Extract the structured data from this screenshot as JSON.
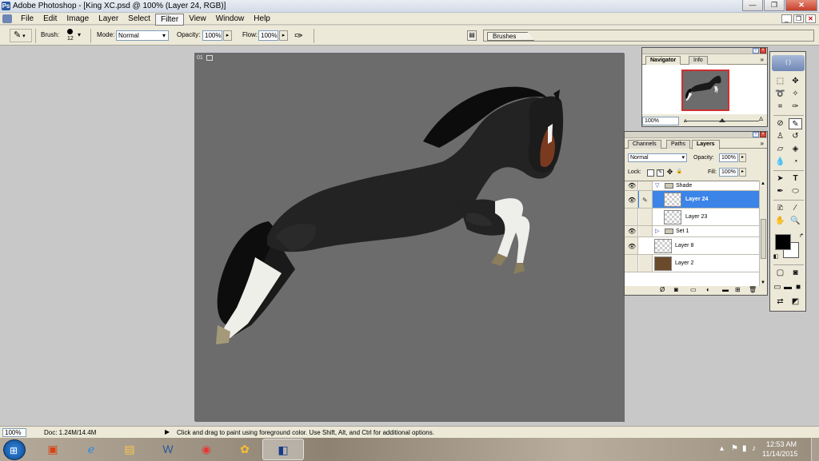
{
  "window": {
    "title": "Adobe Photoshop - [King XC.psd @ 100% (Layer 24, RGB)]",
    "app_icon": "Ps",
    "controls": [
      "—",
      "❐",
      "✕"
    ]
  },
  "menu": {
    "items": [
      "File",
      "Edit",
      "Image",
      "Layer",
      "Select",
      "Filter",
      "View",
      "Window",
      "Help"
    ],
    "active_index": 5,
    "doc_controls": [
      "_",
      "❐",
      "✕"
    ]
  },
  "options": {
    "brush_label": "Brush:",
    "brush_size": "12",
    "mode_label": "Mode:",
    "mode_value": "Normal",
    "opacity_label": "Opacity:",
    "opacity_value": "100%",
    "flow_label": "Flow:",
    "flow_value": "100%",
    "well_tab": "Brushes"
  },
  "document": {
    "corner_label": "01",
    "chart_bg": "#6c6c6c"
  },
  "navigator": {
    "tabs": [
      "Navigator",
      "Info"
    ],
    "zoom": "100%"
  },
  "layers_panel": {
    "tabs": [
      "Channels",
      "Paths",
      "Layers"
    ],
    "blend_mode": "Normal",
    "opacity_label": "Opacity:",
    "opacity_value": "100%",
    "lock_label": "Lock:",
    "fill_label": "Fill:",
    "fill_value": "100%",
    "layers": [
      {
        "name": "Shade",
        "type": "folder",
        "expanded": true
      },
      {
        "name": "Layer 24",
        "type": "layer",
        "selected": true
      },
      {
        "name": "Layer 23",
        "type": "layer",
        "selected": false
      },
      {
        "name": "Set 1",
        "type": "folder",
        "expanded": false
      },
      {
        "name": "Layer 8",
        "type": "layer",
        "selected": false
      },
      {
        "name": "Layer 2",
        "type": "layer",
        "selected": false
      }
    ]
  },
  "toolbox": {
    "foreground": "#000000",
    "background": "#ffffff",
    "active_tool": "brush"
  },
  "status": {
    "zoom": "100%",
    "doc": "Doc: 1.24M/14.4M",
    "message": "Click and drag to paint using foreground color.  Use Shift, Alt, and Ctrl for additional options."
  },
  "taskbar": {
    "time": "12:53 AM",
    "date": "11/14/2015"
  },
  "colors": {
    "selection": "#3c84e8",
    "accent": "#2b5aa0"
  }
}
